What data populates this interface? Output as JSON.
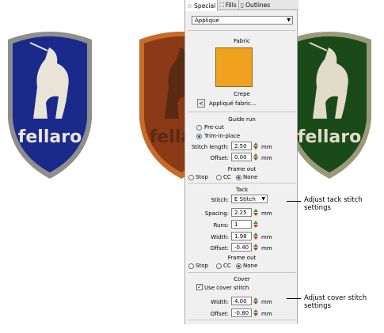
{
  "badges": [
    {
      "brand": "fellaro",
      "fill": "#1a2a8a",
      "border": "#9a9a9a"
    },
    {
      "brand": "fellaro",
      "fill": "#8a3a16",
      "border": "#c86a2a"
    },
    {
      "brand": "fellaro",
      "fill": "#1a4a1a",
      "border": "#9a9a7a"
    }
  ],
  "tabs": [
    {
      "label": "Special",
      "icon": "star-icon",
      "active": true
    },
    {
      "label": "Fills",
      "icon": "fills-icon",
      "active": false
    },
    {
      "label": "Outlines",
      "icon": "outlines-icon",
      "active": false
    }
  ],
  "stitch_type": "Appliqué",
  "fabric": {
    "heading": "Fabric",
    "swatch_color": "#f0a21e",
    "name": "Crepe",
    "button_label": "Appliqué fabric..."
  },
  "guide_run": {
    "heading": "Guide run",
    "options": [
      "Pre-cut",
      "Trim-in-place"
    ],
    "selected": "Trim-in-place",
    "stitch_length_label": "Stitch length:",
    "stitch_length": "2.50",
    "offset_label": "Offset:",
    "offset": "0.00",
    "unit": "mm"
  },
  "frame_out_1": {
    "heading": "Frame out",
    "options": [
      "Stop",
      "CC",
      "None"
    ],
    "selected": "None"
  },
  "tack": {
    "heading": "Tack",
    "stitch_label": "Stitch:",
    "stitch": "E Stitch",
    "spacing_label": "Spacing:",
    "spacing": "2.25",
    "runs_label": "Runs:",
    "runs": "1",
    "width_label": "Width:",
    "width": "1.98",
    "offset_label": "Offset:",
    "offset": "-0.40",
    "unit": "mm"
  },
  "frame_out_2": {
    "heading": "Frame out",
    "options": [
      "Stop",
      "CC",
      "None"
    ],
    "selected": "None"
  },
  "cover": {
    "heading": "Cover",
    "use_label": "Use cover stitch",
    "use_checked": true,
    "width_label": "Width:",
    "width": "4.00",
    "offset_label": "Offset:",
    "offset": "-0.80",
    "unit": "mm"
  },
  "annotations": {
    "tack": "Adjust tack stitch settings",
    "cover": "Adjust cover stitch settings"
  },
  "colors": {
    "accent": "#1c4fa0",
    "spin_up": "#3a9a3a",
    "spin_down": "#c03030"
  }
}
